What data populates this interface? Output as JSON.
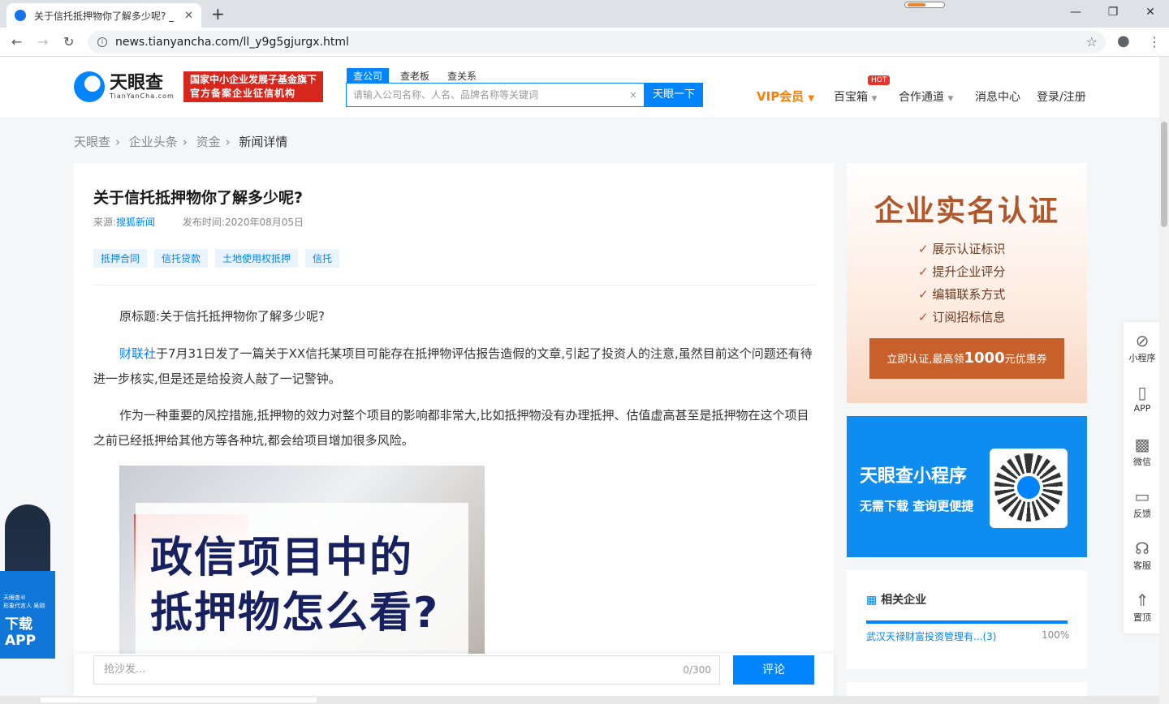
{
  "browser": {
    "tab_title": "关于信托抵押物你了解多少呢? _",
    "tab_close": "✕",
    "new_tab": "+",
    "url": "news.tianyancha.com/ll_y9g5gjurgx.html",
    "win_min": "—",
    "win_max": "❐",
    "win_close": "✕"
  },
  "header": {
    "logo_name": "天眼查",
    "logo_sub": "TianYanCha.com",
    "badge_line1": "国家中小企业发展子基金旗下",
    "badge_line2": "官方备案企业征信机构",
    "search_tabs": [
      "查公司",
      "查老板",
      "查关系"
    ],
    "search_placeholder": "请输入公司名称、人名、品牌名称等关键词",
    "search_button": "天眼一下",
    "vip": "VIP会员",
    "nav": [
      "百宝箱",
      "合作通道",
      "消息中心",
      "登录/注册"
    ],
    "hot": "HOT"
  },
  "breadcrumb": [
    "天眼查",
    "企业头条",
    "资金",
    "新闻详情"
  ],
  "article": {
    "title": "关于信托抵押物你了解多少呢?",
    "source_label": "来源:",
    "source": "搜狐新闻",
    "date_label": "发布时间:",
    "date": "2020年08月05日",
    "tags": [
      "抵押合同",
      "信托贷款",
      "土地使用权抵押",
      "信托"
    ],
    "p1": "原标题:关于信托抵押物你了解多少呢?",
    "p2_link": "财联社",
    "p2": "于7月31日发了一篇关于XX信托某项目可能存在抵押物评估报告造假的文章,引起了投资人的注意,虽然目前这个问题还有待进一步核实,但是还是给投资人敲了一记警钟。",
    "p3": "作为一种重要的风控措施,抵押物的效力对整个项目的影响都非常大,比如抵押物没有办理抵押、估值虚高甚至是抵押物在这个项目之前已经抵押给其他方等各种坑,都会给项目增加很多风险。",
    "image_line1": "政信项目中的",
    "image_line2": "抵押物怎么看?"
  },
  "comment": {
    "placeholder": "抢沙发...",
    "count": "0/300",
    "button": "评论"
  },
  "ad_verify": {
    "title": "企业实名认证",
    "items": [
      "展示认证标识",
      "提升企业评分",
      "编辑联系方式",
      "订阅招标信息"
    ],
    "btn_prefix": "立即认证,最高领",
    "btn_amount": "1000",
    "btn_suffix": "元优惠券"
  },
  "ad_mini": {
    "title": "天眼查小程序",
    "subtitle": "无需下载 查询更便捷"
  },
  "related": {
    "title": "相关企业",
    "company": "武汉天禄财富投资管理有...(3)",
    "percent": "100%"
  },
  "side_toolbar": [
    "小程序",
    "APP",
    "微信",
    "反馈",
    "客服",
    "置顶"
  ],
  "app_banner": {
    "caption1": "天眼查®",
    "caption2": "形象代言人 吴刚",
    "line1": "下载",
    "line2": "APP"
  },
  "colors": {
    "brand": "#0084ff",
    "vip": "#ff7d00",
    "badge": "#d7271d"
  }
}
